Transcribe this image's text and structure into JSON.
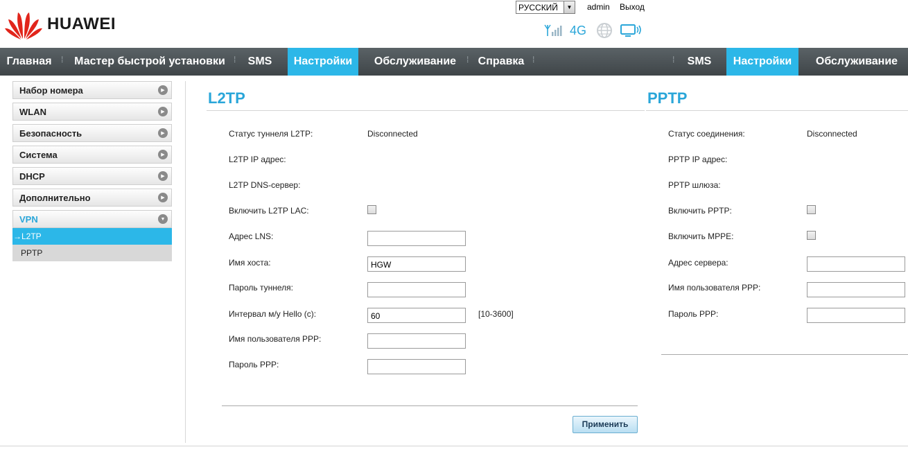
{
  "header": {
    "brand": "HUAWEI",
    "language": "РУССКИЙ",
    "user": "admin",
    "logout": "Выход",
    "network_type": "4G"
  },
  "nav": {
    "items": [
      "Главная",
      "Мастер быстрой установки",
      "SMS",
      "Настройки",
      "Обслуживание",
      "Справка"
    ],
    "items_right": [
      "SMS",
      "Настройки",
      "Обслуживание"
    ]
  },
  "sidebar": {
    "items": [
      "Набор номера",
      "WLAN",
      "Безопасность",
      "Система",
      "DHCP",
      "Дополнительно",
      "VPN"
    ],
    "sub_items": [
      "→L2TP",
      "PPTP"
    ]
  },
  "l2tp": {
    "title": "L2TP",
    "status_label": "Статус туннеля L2TP:",
    "status_value": "Disconnected",
    "ip_label": "L2TP IP адрес:",
    "dns_label": "L2TP DNS-сервер:",
    "lac_label": "Включить L2TP LAC:",
    "lns_label": "Адрес LNS:",
    "lns_value": "",
    "host_label": "Имя хоста:",
    "host_value": "HGW",
    "tunnel_pw_label": "Пароль туннеля:",
    "tunnel_pw_value": "",
    "hello_label": "Интервал м/у Hello (с):",
    "hello_value": "60",
    "hello_hint": "[10-3600]",
    "ppp_user_label": "Имя пользователя PPP:",
    "ppp_user_value": "",
    "ppp_pw_label": "Пароль PPP:",
    "ppp_pw_value": "",
    "apply": "Применить"
  },
  "pptp": {
    "title": "PPTP",
    "status_label": "Статус соединения:",
    "status_value": "Disconnected",
    "ip_label": "PPTP IP адрес:",
    "gateway_label": "PPTP шлюза:",
    "enable_label": "Включить PPTP:",
    "mppe_label": "Включить MPPE:",
    "server_label": "Адрес сервера:",
    "server_value": "",
    "user_label": "Имя пользователя PPP:",
    "user_value": "",
    "pw_label": "Пароль PPP:",
    "pw_value": ""
  },
  "colors": {
    "accent": "#2cb7e8",
    "nav_bg": "#4a5154",
    "title": "#2aa6d9"
  }
}
